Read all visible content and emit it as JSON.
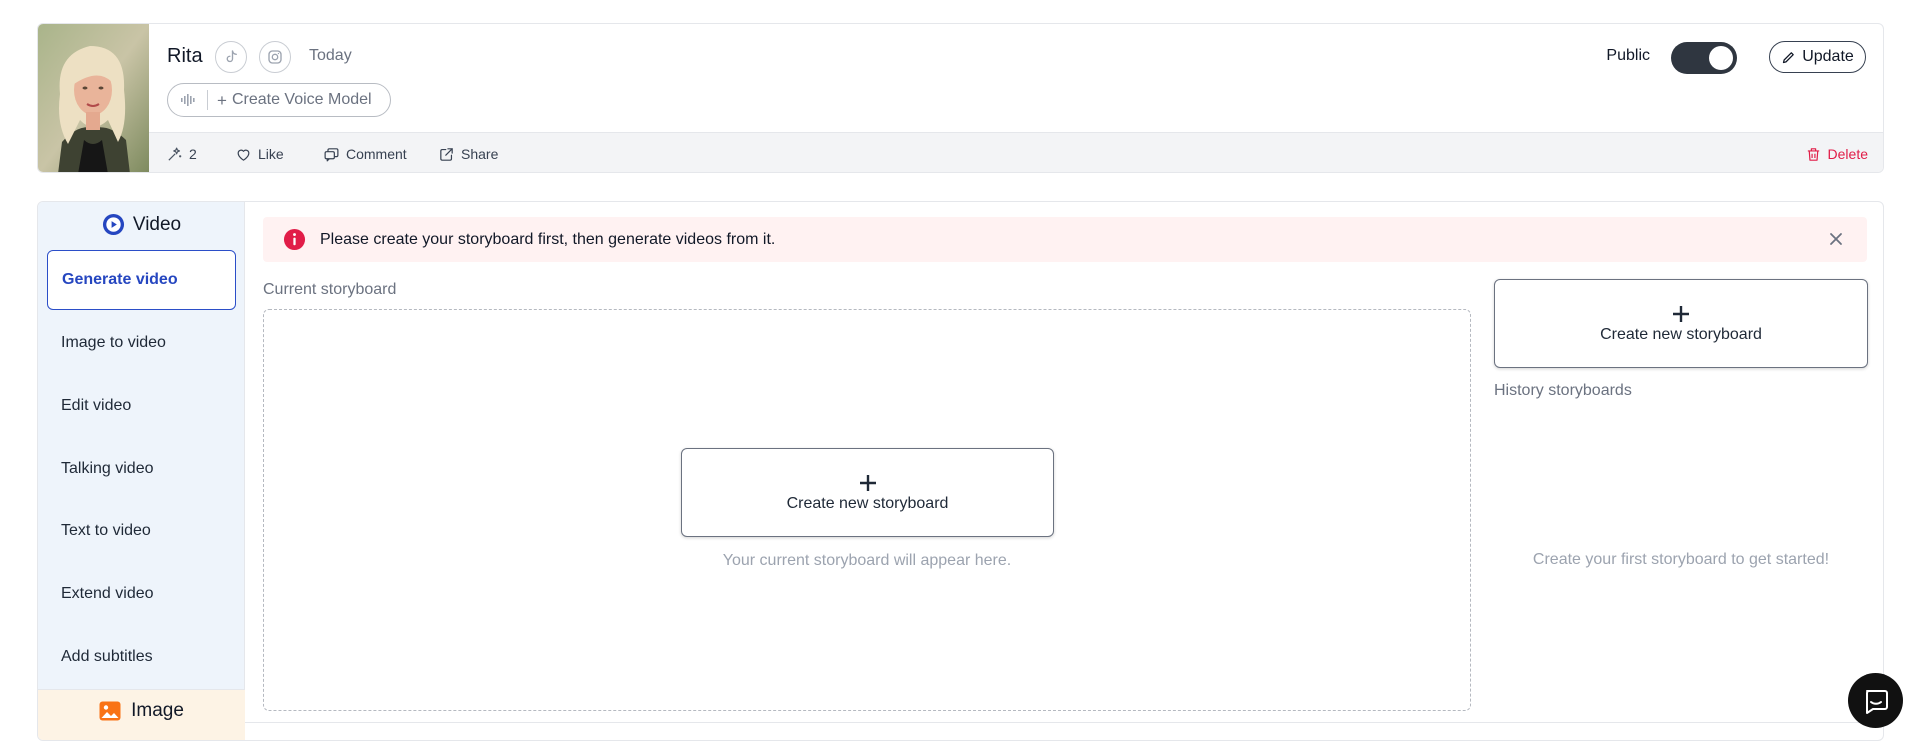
{
  "profile": {
    "name": "Rita",
    "date": "Today",
    "social_icons": [
      "tiktok-icon",
      "instagram-icon"
    ],
    "voice_model_label": "Create Voice Model",
    "public_label": "Public",
    "public_enabled": true,
    "update_label": "Update",
    "actions": {
      "sparkle_count": "2",
      "like_label": "Like",
      "comment_label": "Comment",
      "share_label": "Share",
      "delete_label": "Delete"
    }
  },
  "sidebar": {
    "section_title": "Video",
    "items": [
      {
        "label": "Generate video",
        "active": true
      },
      {
        "label": "Image to video",
        "active": false
      },
      {
        "label": "Edit video",
        "active": false
      },
      {
        "label": "Talking video",
        "active": false
      },
      {
        "label": "Text to video",
        "active": false
      },
      {
        "label": "Extend video",
        "active": false
      },
      {
        "label": "Add subtitles",
        "active": false
      }
    ],
    "next_section_title": "Image"
  },
  "main": {
    "alert_text": "Please create your storyboard first, then generate videos from it.",
    "current_label": "Current storyboard",
    "create_label": "Create new storyboard",
    "current_empty": "Your current storyboard will appear here.",
    "history_label": "History storyboards",
    "history_empty": "Create your first storyboard to get started!"
  },
  "colors": {
    "accent_blue": "#2546c0",
    "danger": "#e11d48",
    "alert_bg": "#fff2f2",
    "sidebar_bg": "#eef4fb",
    "toggle_on": "#2f3640"
  }
}
